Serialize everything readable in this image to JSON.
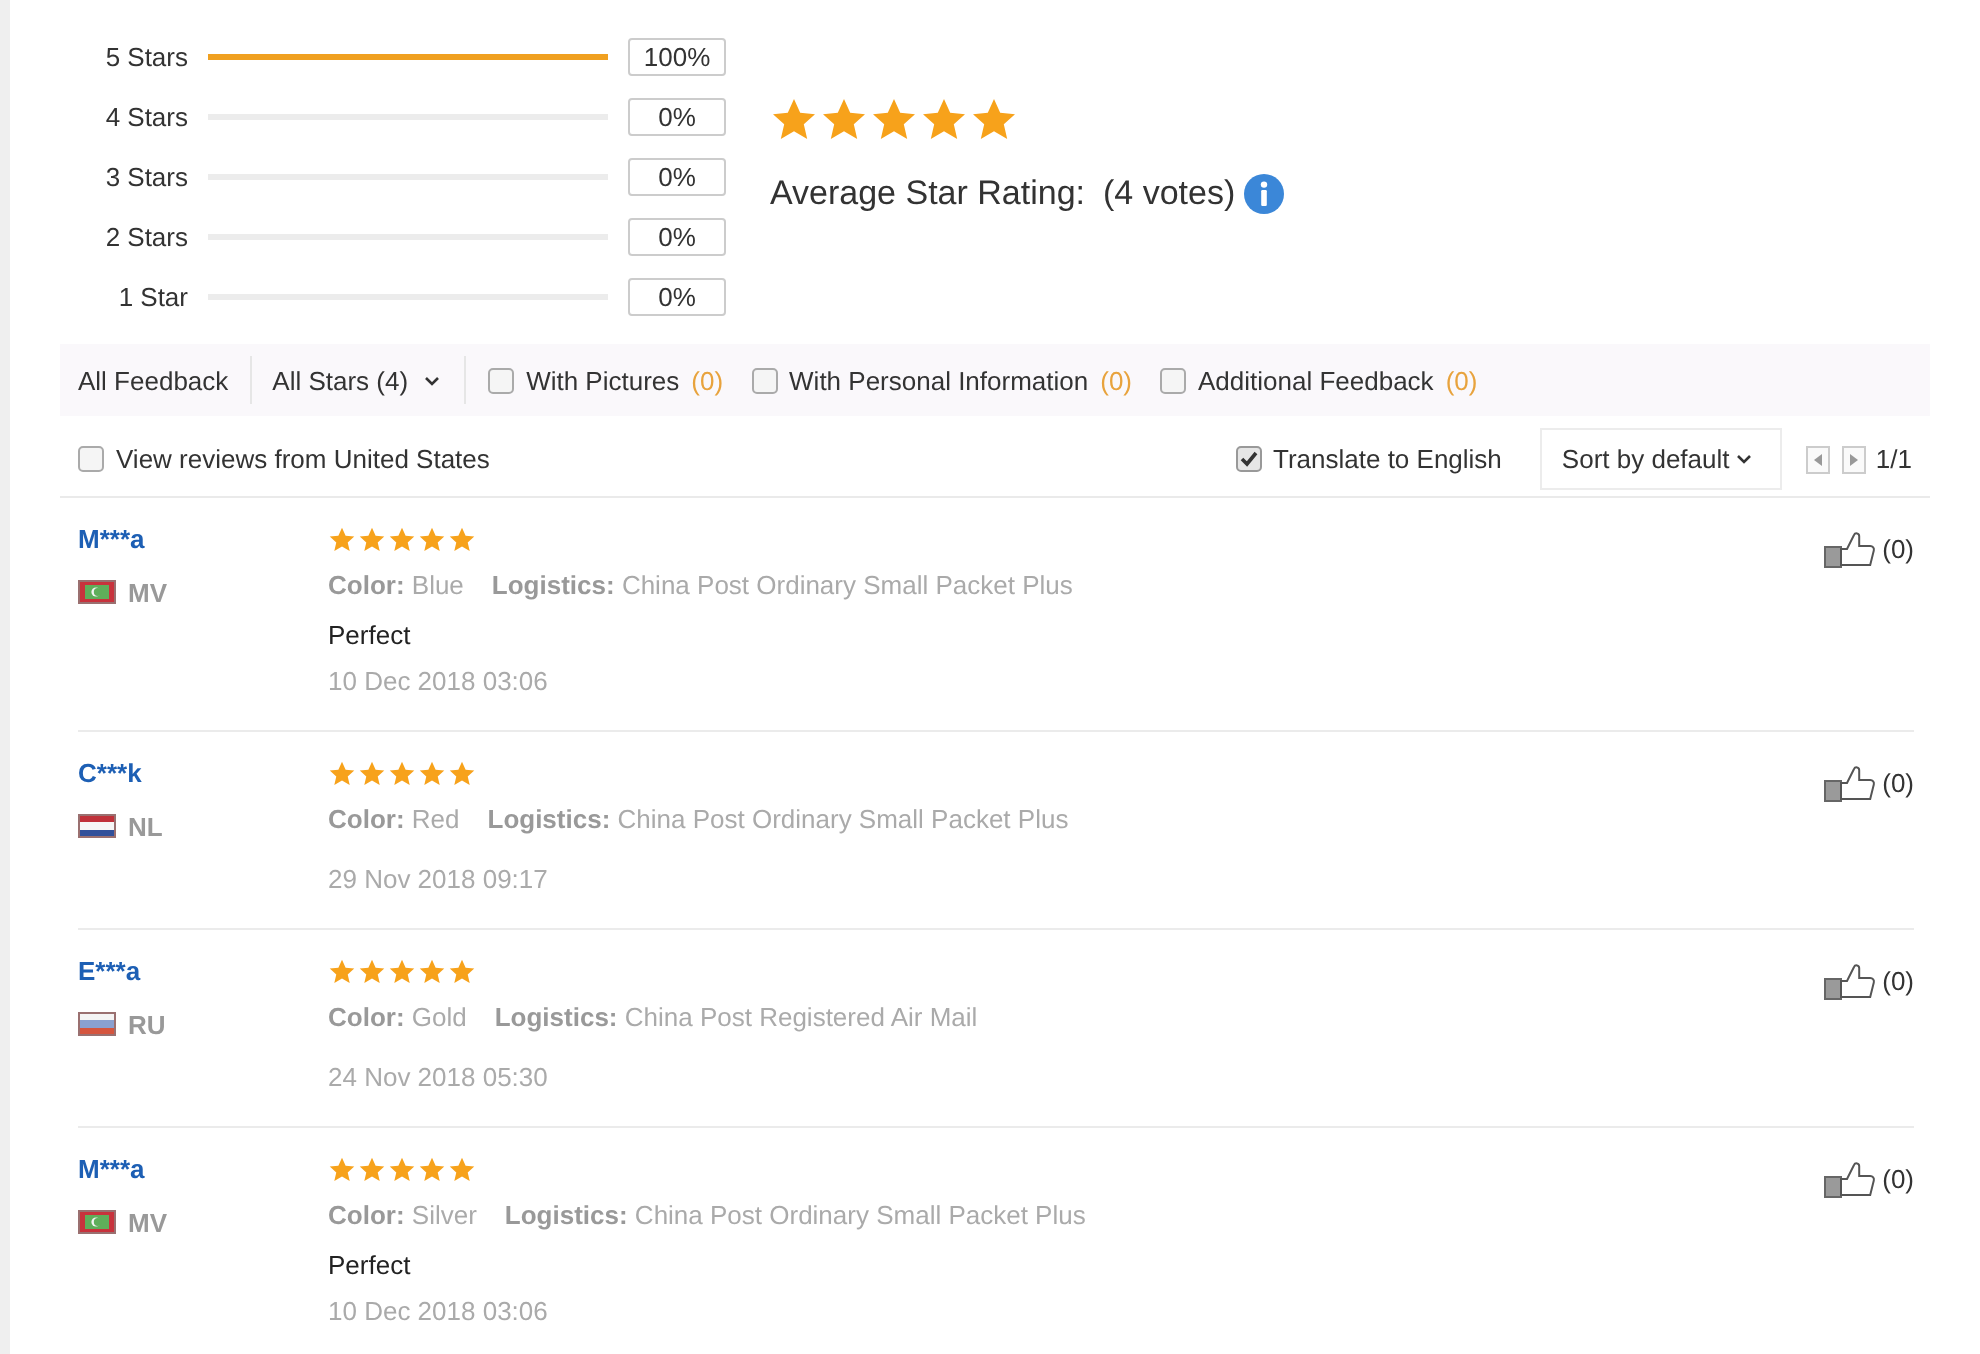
{
  "rating_summary": {
    "rows": [
      {
        "label": "5 Stars",
        "level": 1,
        "percent": "100%"
      },
      {
        "label": "4 Stars",
        "level": 0,
        "percent": "0%"
      },
      {
        "label": "3 Stars",
        "level": 0,
        "percent": "0%"
      },
      {
        "label": "2 Stars",
        "level": 0,
        "percent": "0%"
      },
      {
        "label": "1 Star",
        "level": 0,
        "percent": "0%"
      }
    ],
    "stars": 5,
    "average_label": "Average Star Rating:",
    "votes": "(4 votes)"
  },
  "filters": {
    "all_feedback": "All Feedback",
    "stars_dropdown": "All Stars (4)",
    "options": [
      {
        "label": "With Pictures",
        "count": "(0)",
        "checked": false
      },
      {
        "label": "With Personal Information",
        "count": "(0)",
        "checked": false
      },
      {
        "label": "Additional Feedback",
        "count": "(0)",
        "checked": false
      }
    ]
  },
  "toolbar": {
    "country_filter": {
      "label": "View reviews from United States",
      "checked": false
    },
    "translate": {
      "label": "Translate to English",
      "checked": true
    },
    "sort": "Sort by default",
    "page": "1/1"
  },
  "reviews": [
    {
      "name": "M***a",
      "flag": {
        "kind": "maldives"
      },
      "country": "MV",
      "stars": 5,
      "details": [
        "**Color:** Blue",
        "**Logistics:** China Post Ordinary Small Packet Plus"
      ],
      "comment": "Perfect",
      "date": "10 Dec 2018 03:06",
      "likes": "(0)"
    },
    {
      "name": "C***k",
      "flag": {
        "kind": "netherlands"
      },
      "country": "NL",
      "stars": 5,
      "details": [
        "**Color:** Red",
        "**Logistics:** China Post Ordinary Small Packet Plus"
      ],
      "date": "29 Nov 2018 09:17",
      "likes": "(0)"
    },
    {
      "name": "E***a",
      "flag": {
        "kind": "russia"
      },
      "country": "RU",
      "stars": 5,
      "details": [
        "**Color:** Gold",
        "**Logistics:** China Post Registered Air Mail"
      ],
      "date": "24 Nov 2018 05:30",
      "likes": "(0)"
    },
    {
      "name": "M***a",
      "flag": {
        "kind": "maldives"
      },
      "country": "MV",
      "stars": 5,
      "details": [
        "**Color:** Silver",
        "**Logistics:** China Post Ordinary Small Packet Plus"
      ],
      "comment": "Perfect",
      "date": "10 Dec 2018 03:06",
      "likes": "(0)"
    }
  ]
}
